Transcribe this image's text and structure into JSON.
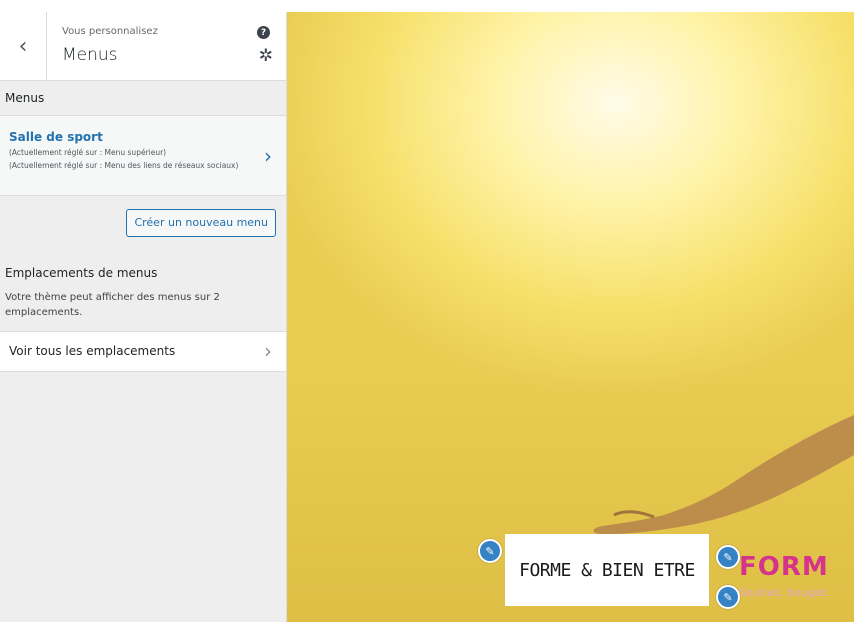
{
  "header": {
    "back_icon": "chevron-left-icon",
    "subtitle": "Vous personnalisez",
    "title": "Menus",
    "help_icon": "question-mark-icon",
    "help_glyph": "?",
    "gear_icon": "gear-icon"
  },
  "menus_section": {
    "title": "Menus",
    "menu": {
      "name": "Salle de sport",
      "location_1": "(Actuellement réglé sur : Menu supérieur)",
      "location_2": "(Actuellement réglé sur : Menu des liens de réseaux sociaux)"
    },
    "create_button": "Créer un nouveau menu"
  },
  "locations_section": {
    "title": "Emplacements de menus",
    "description": "Votre thème peut afficher des menus sur 2 emplacements.",
    "view_all": "Voir tous les emplacements"
  },
  "preview": {
    "logo_text": "FORME & BIEN ETRE",
    "site_title": "FORM",
    "tagline": "Souriez, bougez",
    "colors": {
      "accent": "#2271b1",
      "brand": "#d6338d",
      "tagline": "#e8a6c9",
      "edit_pen": "#3582c4"
    }
  }
}
